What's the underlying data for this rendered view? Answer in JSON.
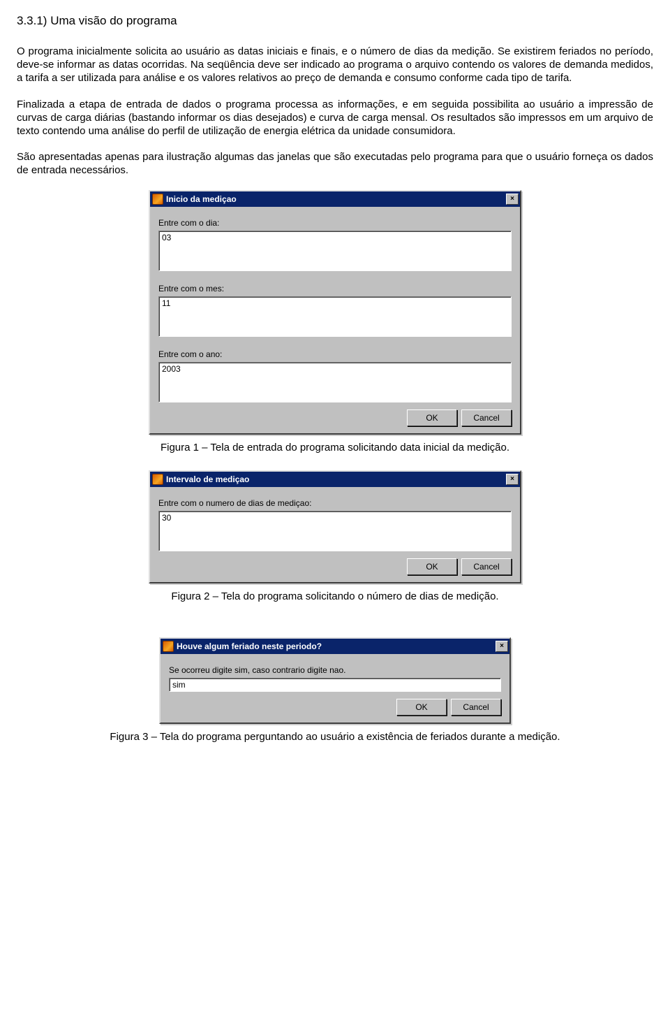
{
  "section_number": "3.3.1) Uma visão do programa",
  "paragraphs": {
    "p1": "O programa inicialmente solicita ao usuário as datas iniciais e finais, e o número de dias da medição. Se existirem feriados no período, deve-se informar as datas ocorridas. Na seqüência deve ser indicado ao programa o arquivo contendo os valores de demanda medidos, a tarifa a ser utilizada para análise e os valores relativos ao preço de demanda e consumo conforme cada tipo de tarifa.",
    "p2": "Finalizada a etapa de entrada de dados o programa processa as informações, e em seguida possibilita ao usuário a impressão de curvas de carga diárias (bastando informar os dias desejados) e curva de carga mensal. Os resultados são impressos em um arquivo de texto contendo uma análise do perfil de utilização de energia elétrica da unidade consumidora.",
    "p3": "São apresentadas apenas para ilustração algumas das janelas que são executadas pelo programa para que o usuário forneça os dados de entrada necessários."
  },
  "dialog1": {
    "title": "Inicio da mediçao",
    "label_dia": "Entre com o dia:",
    "value_dia": "03",
    "label_mes": "Entre com o mes:",
    "value_mes": "11",
    "label_ano": "Entre com o ano:",
    "value_ano": "2003",
    "ok": "OK",
    "cancel": "Cancel",
    "close_x": "×"
  },
  "caption1": "Figura 1 – Tela de entrada do programa solicitando data inicial da medição.",
  "dialog2": {
    "title": "Intervalo de mediçao",
    "label_dias": "Entre com o numero de dias de mediçao:",
    "value_dias": "30",
    "ok": "OK",
    "cancel": "Cancel",
    "close_x": "×"
  },
  "caption2": "Figura 2 – Tela do programa solicitando o número de dias de medição.",
  "dialog3": {
    "title": "Houve algum feriado neste periodo?",
    "label": "Se ocorreu digite sim, caso contrario digite nao.",
    "value": "sim",
    "ok": "OK",
    "cancel": "Cancel",
    "close_x": "×"
  },
  "caption3": "Figura 3 – Tela do programa perguntando ao usuário a existência de feriados durante a medição."
}
